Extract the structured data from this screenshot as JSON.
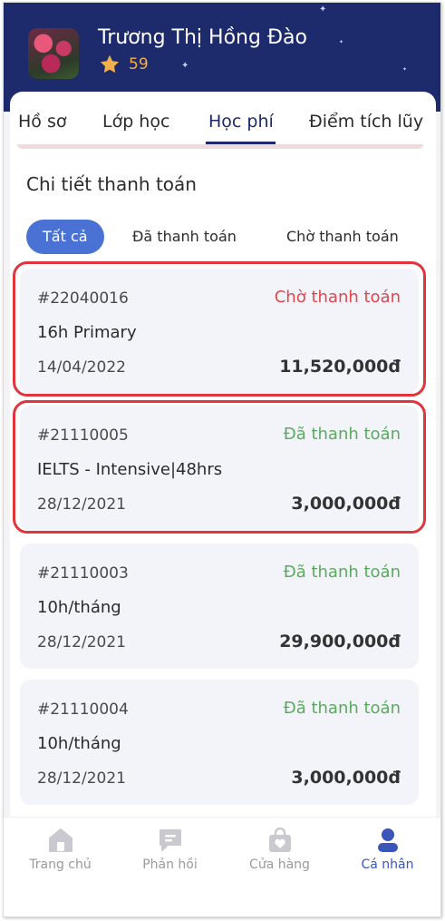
{
  "header": {
    "user_name": "Trương Thị Hồng Đào",
    "points": "59"
  },
  "tabs": [
    {
      "label": "Hồ sơ"
    },
    {
      "label": "Lớp học"
    },
    {
      "label": "Học phí",
      "active": true
    },
    {
      "label": "Điểm tích lũy"
    }
  ],
  "section_title": "Chi tiết thanh toán",
  "filters": [
    {
      "label": "Tất cả",
      "active": true
    },
    {
      "label": "Đã thanh toán"
    },
    {
      "label": "Chờ thanh toán"
    }
  ],
  "payments": [
    {
      "id": "#22040016",
      "status": "Chờ thanh toán",
      "status_color": "#e0474c",
      "course": "16h Primary",
      "date": "14/04/2022",
      "amount": "11,520,000đ"
    },
    {
      "id": "#21110005",
      "status": "Đã thanh toán",
      "status_color": "#5aaa5e",
      "course": "IELTS - Intensive|48hrs",
      "date": "28/12/2021",
      "amount": "3,000,000đ"
    },
    {
      "id": "#21110003",
      "status": "Đã thanh toán",
      "status_color": "#5aaa5e",
      "course": "10h/tháng",
      "date": "28/12/2021",
      "amount": "29,900,000đ"
    },
    {
      "id": "#21110004",
      "status": "Đã thanh toán",
      "status_color": "#5aaa5e",
      "course": "10h/tháng",
      "date": "28/12/2021",
      "amount": "3,000,000đ"
    }
  ],
  "bottom_nav": [
    {
      "label": "Trang chủ",
      "icon": "home-icon"
    },
    {
      "label": "Phản hồi",
      "icon": "feedback-icon"
    },
    {
      "label": "Cửa hàng",
      "icon": "shop-icon"
    },
    {
      "label": "Cá nhân",
      "icon": "profile-icon",
      "active": true
    }
  ],
  "colors": {
    "header_bg": "#1d2a6b",
    "accent": "#4a72d4",
    "pending": "#e0474c",
    "paid": "#5aaa5e",
    "highlight": "#e0353d"
  }
}
